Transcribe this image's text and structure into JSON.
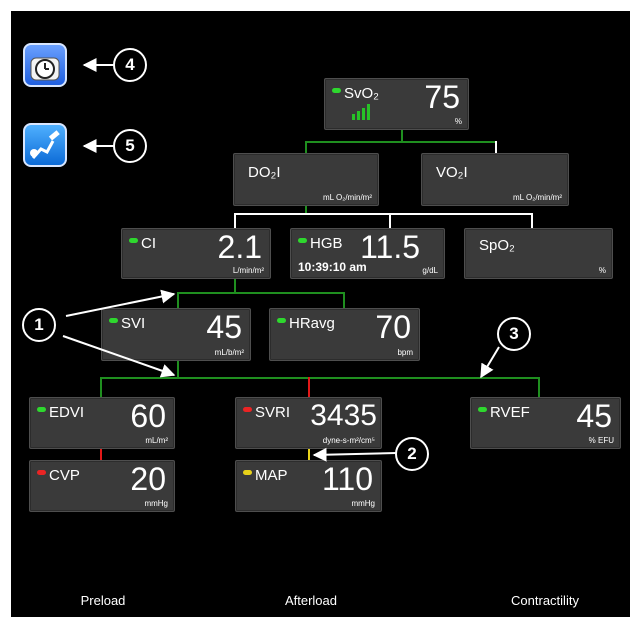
{
  "tiles": {
    "svo2": {
      "label": "SvO₂",
      "value": "75",
      "unit": "%",
      "status_color": "#2ed82e",
      "signal_quality": "4 of 4 bars"
    },
    "do2i": {
      "label": "DO₂I",
      "value": "",
      "unit": "mL O₂/min/m²"
    },
    "vo2i": {
      "label": "VO₂I",
      "value": "",
      "unit": "mL O₂/min/m²"
    },
    "ci": {
      "label": "CI",
      "value": "2.1",
      "unit": "L/min/m²",
      "status_color": "#2ed82e"
    },
    "hgb": {
      "label": "HGB",
      "value": "11.5",
      "unit": "g/dL",
      "time": "10:39:10 am",
      "status_color": "#2ed82e"
    },
    "spo2": {
      "label": "SpO₂",
      "value": "",
      "unit": "%"
    },
    "svi": {
      "label": "SVI",
      "value": "45",
      "unit": "mL/b/m²",
      "status_color": "#2ed82e"
    },
    "hravg": {
      "label": "HRavg",
      "value": "70",
      "unit": "bpm",
      "status_color": "#2ed82e"
    },
    "edvi": {
      "label": "EDVI",
      "value": "60",
      "unit": "mL/m²",
      "status_color": "#2ed82e"
    },
    "svri": {
      "label": "SVRI",
      "value": "3435",
      "unit": "dyne-s-m²/cm⁵",
      "status_color": "#ea2424"
    },
    "rvef": {
      "label": "RVEF",
      "value": "45",
      "unit": "% EFU",
      "status_color": "#2ed82e"
    },
    "cvp": {
      "label": "CVP",
      "value": "20",
      "unit": "mmHg",
      "status_color": "#ea2424"
    },
    "map": {
      "label": "MAP",
      "value": "110",
      "unit": "mmHg",
      "status_color": "#e8d21a"
    }
  },
  "callouts": {
    "c1": "1",
    "c2": "2",
    "c3": "3",
    "c4": "4",
    "c5": "5"
  },
  "icons": {
    "clock": "clock-icon",
    "fluid": "syringe-person-icon"
  },
  "footer": {
    "preload": "Preload",
    "afterload": "Afterload",
    "contractility": "Contractility"
  },
  "colors": {
    "background": "#000000",
    "tile": "#3a3a3a",
    "line_green": "#1f8f1f",
    "line_white": "#ffffff",
    "alert_red": "#e31818",
    "alert_yellow": "#e8d21a"
  }
}
